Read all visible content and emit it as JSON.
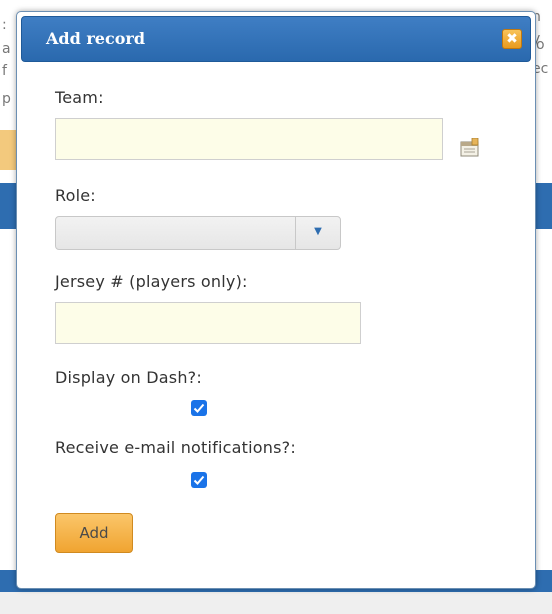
{
  "background": {
    "fragment_right_1": "n y",
    "fragment_right_2": "o",
    "fragment_right_3": "ec",
    "fragment_left_1": ":",
    "fragment_left_2": "a",
    "fragment_left_3": "f",
    "fragment_left_4": "p"
  },
  "dialog": {
    "title": "Add record",
    "close_icon": "close-icon"
  },
  "form": {
    "team_label": "Team:",
    "team_value": "",
    "role_label": "Role:",
    "role_value": "",
    "jersey_label": "Jersey # (players only):",
    "jersey_value": "",
    "display_label": "Display on Dash?:",
    "display_checked": true,
    "notify_label": "Receive e-mail notifications?:",
    "notify_checked": true,
    "add_label": "Add"
  },
  "icons": {
    "picker": "calendar-picker-icon",
    "dropdown": "chevron-down-icon",
    "check": "check-icon"
  },
  "colors": {
    "title_bar": "#2e6db0",
    "input_bg": "#fdfde8",
    "button_orange": "#f0a431",
    "checkbox_blue": "#1a73e8"
  }
}
